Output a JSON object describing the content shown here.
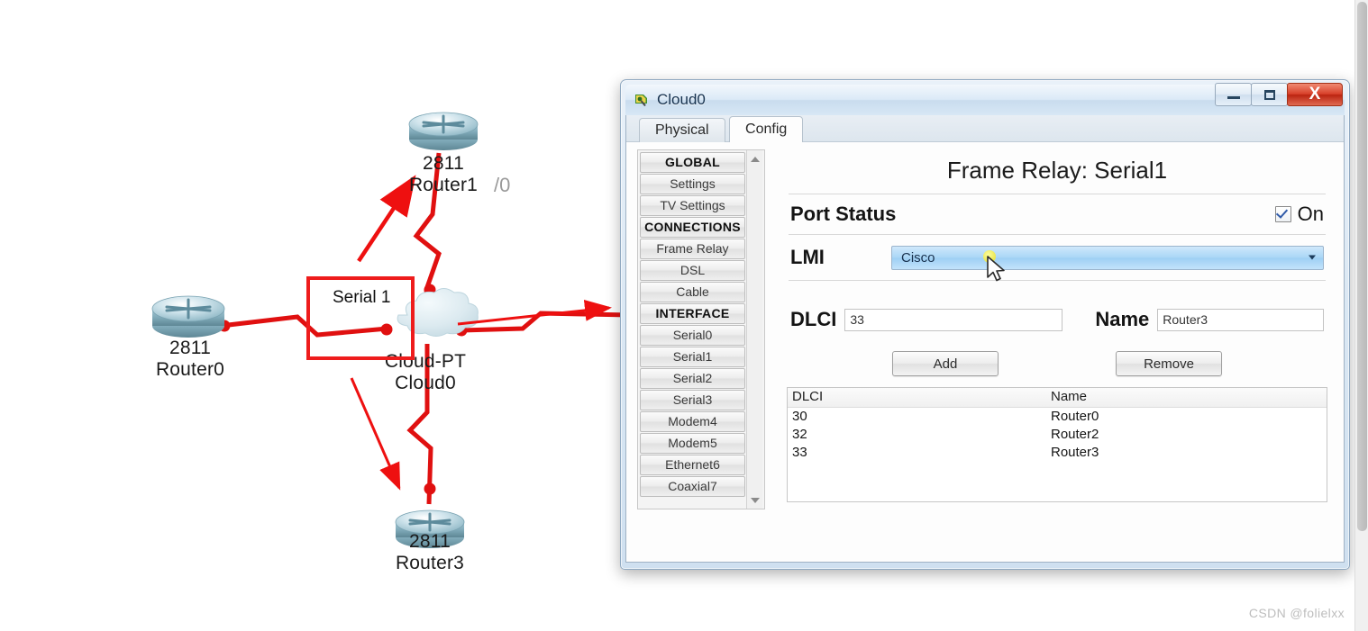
{
  "topology": {
    "nodes": [
      {
        "id": "router0",
        "model": "2811",
        "name": "Router0"
      },
      {
        "id": "router1",
        "model": "2811",
        "name": "Router1"
      },
      {
        "id": "router3",
        "model": "2811",
        "name": "Router3"
      },
      {
        "id": "cloud0",
        "model": "Cloud-PT",
        "name": "Cloud0"
      }
    ],
    "router1_port_suffix": "/0",
    "annotation": {
      "box_label": "Serial 1",
      "color": "#ee1c1c"
    },
    "link_color": "#e01010"
  },
  "window": {
    "title": "Cloud0",
    "icon": "packet-tracer-icon",
    "buttons": {
      "minimize": "minimize",
      "maximize": "maximize",
      "close": "X"
    },
    "tabs": [
      {
        "label": "Physical",
        "active": false
      },
      {
        "label": "Config",
        "active": true
      }
    ],
    "sidebar": {
      "items": [
        {
          "label": "GLOBAL",
          "header": true
        },
        {
          "label": "Settings",
          "header": false
        },
        {
          "label": "TV Settings",
          "header": false
        },
        {
          "label": "CONNECTIONS",
          "header": true
        },
        {
          "label": "Frame Relay",
          "header": false
        },
        {
          "label": "DSL",
          "header": false
        },
        {
          "label": "Cable",
          "header": false
        },
        {
          "label": "INTERFACE",
          "header": true
        },
        {
          "label": "Serial0",
          "header": false
        },
        {
          "label": "Serial1",
          "header": false
        },
        {
          "label": "Serial2",
          "header": false
        },
        {
          "label": "Serial3",
          "header": false
        },
        {
          "label": "Modem4",
          "header": false
        },
        {
          "label": "Modem5",
          "header": false
        },
        {
          "label": "Ethernet6",
          "header": false
        },
        {
          "label": "Coaxial7",
          "header": false
        }
      ]
    },
    "panel": {
      "title": "Frame Relay: Serial1",
      "port_status_label": "Port Status",
      "port_status_on_label": "On",
      "port_status_checked": true,
      "lmi_label": "LMI",
      "lmi_value": "Cisco",
      "dlci_label": "DLCI",
      "dlci_value": "33",
      "name_label": "Name",
      "name_value": "Router3",
      "add_label": "Add",
      "remove_label": "Remove",
      "table": {
        "columns": [
          "DLCI",
          "Name"
        ],
        "rows": [
          {
            "dlci": "30",
            "name": "Router0"
          },
          {
            "dlci": "32",
            "name": "Router2"
          },
          {
            "dlci": "33",
            "name": "Router3"
          }
        ]
      }
    }
  },
  "watermark": "CSDN @folielxx",
  "colors": {
    "accent_red": "#e01010",
    "select_blue": "#a9d6f6",
    "check_blue": "#2f5aa8",
    "highlight_yellow": "#f2ec55"
  }
}
